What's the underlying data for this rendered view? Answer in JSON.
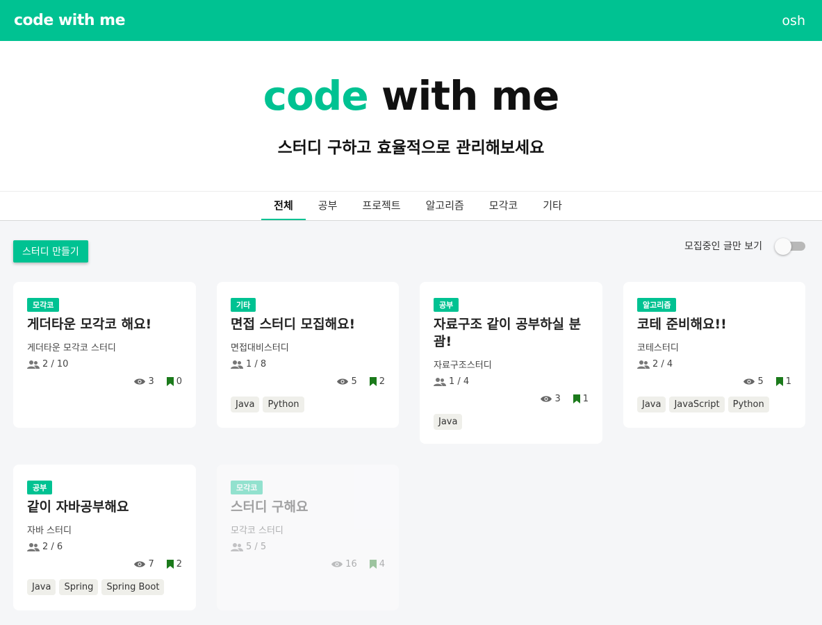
{
  "header": {
    "logo": "code with me",
    "user": "osh"
  },
  "hero": {
    "title_accent": "code",
    "title_rest": " with me",
    "subtitle": "스터디 구하고 효율적으로 관리해보세요"
  },
  "tabs": [
    {
      "label": "전체",
      "active": true
    },
    {
      "label": "공부"
    },
    {
      "label": "프로젝트"
    },
    {
      "label": "알고리즘"
    },
    {
      "label": "모각코"
    },
    {
      "label": "기타"
    }
  ],
  "toolbar": {
    "create_label": "스터디 만들기",
    "toggle_label": "모집중인 글만 보기",
    "toggle_on": false
  },
  "colors": {
    "accent": "#00c292",
    "bookmark": "#1b7a1b",
    "eye": "#666666"
  },
  "cards": [
    {
      "category": "모각코",
      "title": "게더타운 모각코 해요!",
      "desc": "게더타운 모각코 스터디",
      "members": "2 / 10",
      "views": "3",
      "bookmarks": "0",
      "tags": []
    },
    {
      "category": "기타",
      "title": "면접 스터디 모집해요!",
      "desc": "면접대비스터디",
      "members": "1 / 8",
      "views": "5",
      "bookmarks": "2",
      "tags": [
        "Java",
        "Python"
      ]
    },
    {
      "category": "공부",
      "title": "자료구조 같이 공부하실 분 괌!",
      "desc": "자료구조스터디",
      "members": "1 / 4",
      "views": "3",
      "bookmarks": "1",
      "tags": [
        "Java"
      ]
    },
    {
      "category": "알고리즘",
      "title": "코테 준비해요!!",
      "desc": "코테스터디",
      "members": "2 / 4",
      "views": "5",
      "bookmarks": "1",
      "tags": [
        "Java",
        "JavaScript",
        "Python"
      ]
    },
    {
      "category": "공부",
      "title": "같이 자바공부해요",
      "desc": "자바 스터디",
      "members": "2 / 6",
      "views": "7",
      "bookmarks": "2",
      "tags": [
        "Java",
        "Spring",
        "Spring Boot"
      ]
    },
    {
      "category": "모각코",
      "title": "스터디 구해요",
      "desc": "모각코 스터디",
      "members": "5 / 5",
      "views": "16",
      "bookmarks": "4",
      "tags": [],
      "closed": true
    }
  ]
}
